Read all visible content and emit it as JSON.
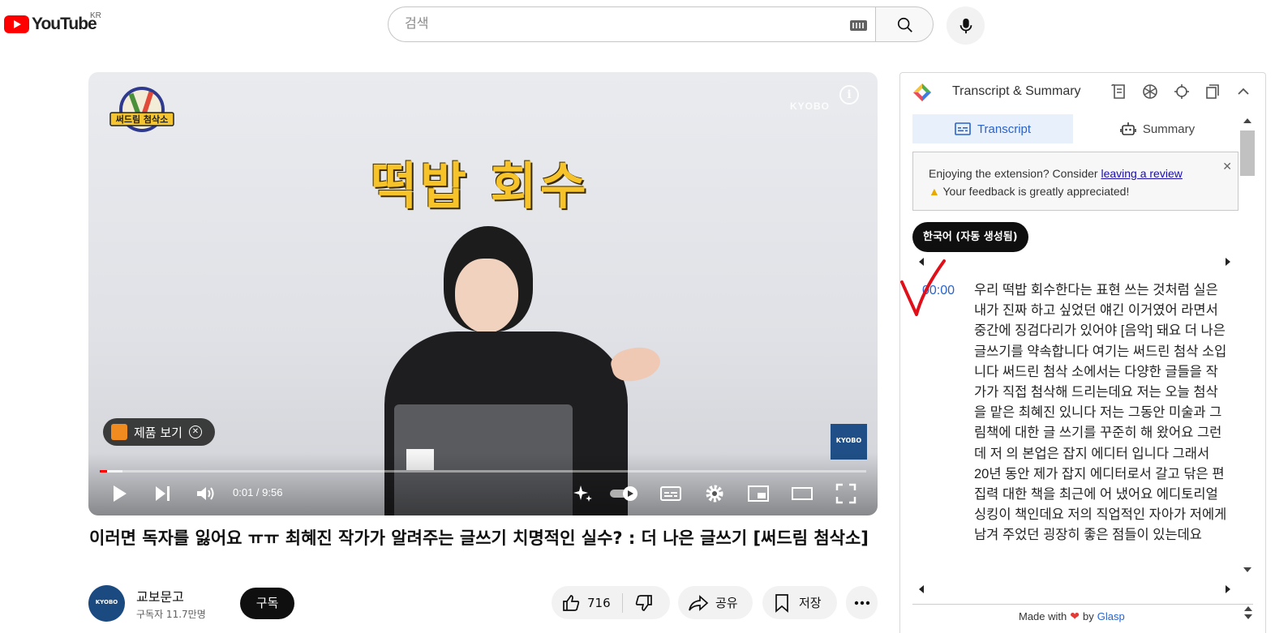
{
  "header": {
    "logo_text": "YouTube",
    "country": "KR",
    "search_placeholder": "검색"
  },
  "player": {
    "badge_text": "써드림 첨삭소",
    "overlay_title": "떡밥 회수",
    "watermark": "KYOBO",
    "product_label": "제품 보기",
    "corner_logo": "KYOBO",
    "time": "0:01 / 9:56",
    "progress": 0.002,
    "buffered": 0.03
  },
  "video": {
    "title": "이러면 독자를 잃어요 ㅠㅠ 최혜진 작가가 알려주는 글쓰기 치명적인 실수? : 더 나은 글쓰기 [써드림 첨삭소]",
    "channel_name": "교보문고",
    "channel_avatar": "KYOBO",
    "subscribers": "구독자 11.7만명",
    "subscribe_label": "구독",
    "like_count": "716",
    "share_label": "공유",
    "save_label": "저장"
  },
  "panel": {
    "title": "Transcript & Summary",
    "tab_transcript": "Transcript",
    "tab_summary": "Summary",
    "notice_text": "Enjoying the extension? Consider",
    "notice_link": "leaving a review",
    "notice_text2": "Your feedback is greatly appreciated!",
    "language": "한국어 (자동 생성됨)",
    "timestamp": "00:00",
    "transcript": "우리 떡밥 회수한다는 표현 쓰는 것처럼 실은 내가 진짜 하고 싶었던 얘긴 이거였어 라면서 중간에 징검다리가 있어야 [음악] 돼요 더 나은 글쓰기를 약속합니다 여기는 써드린 첨삭 소입니다 써드린 첨삭 소에서는 다양한 글들을 작가가 직접 첨삭해 드리는데요 저는 오늘 첨삭을 맡은 최혜진 있니다 저는 그동안 미술과 그림책에 대한 글 쓰기를 꾸준히 해 왔어요 그런데 저 의 본업은 잡지 에디터 입니다 그래서 20년 동안 제가 잡지 에디터로서 갈고 닦은 편집력 대한 책을 최근에 어 냈어요 에디토리얼 싱킹이 책인데요 저의 직업적인 자아가 저에게 남겨 주었던 굉장히 좋은 점들이 있는데요",
    "made_with": "Made with",
    "by": "by",
    "brand": "Glasp"
  },
  "colors": {
    "accent_red": "#ff0000",
    "panel_blue": "#2a63c9",
    "title_yellow": "#f6c32a"
  }
}
